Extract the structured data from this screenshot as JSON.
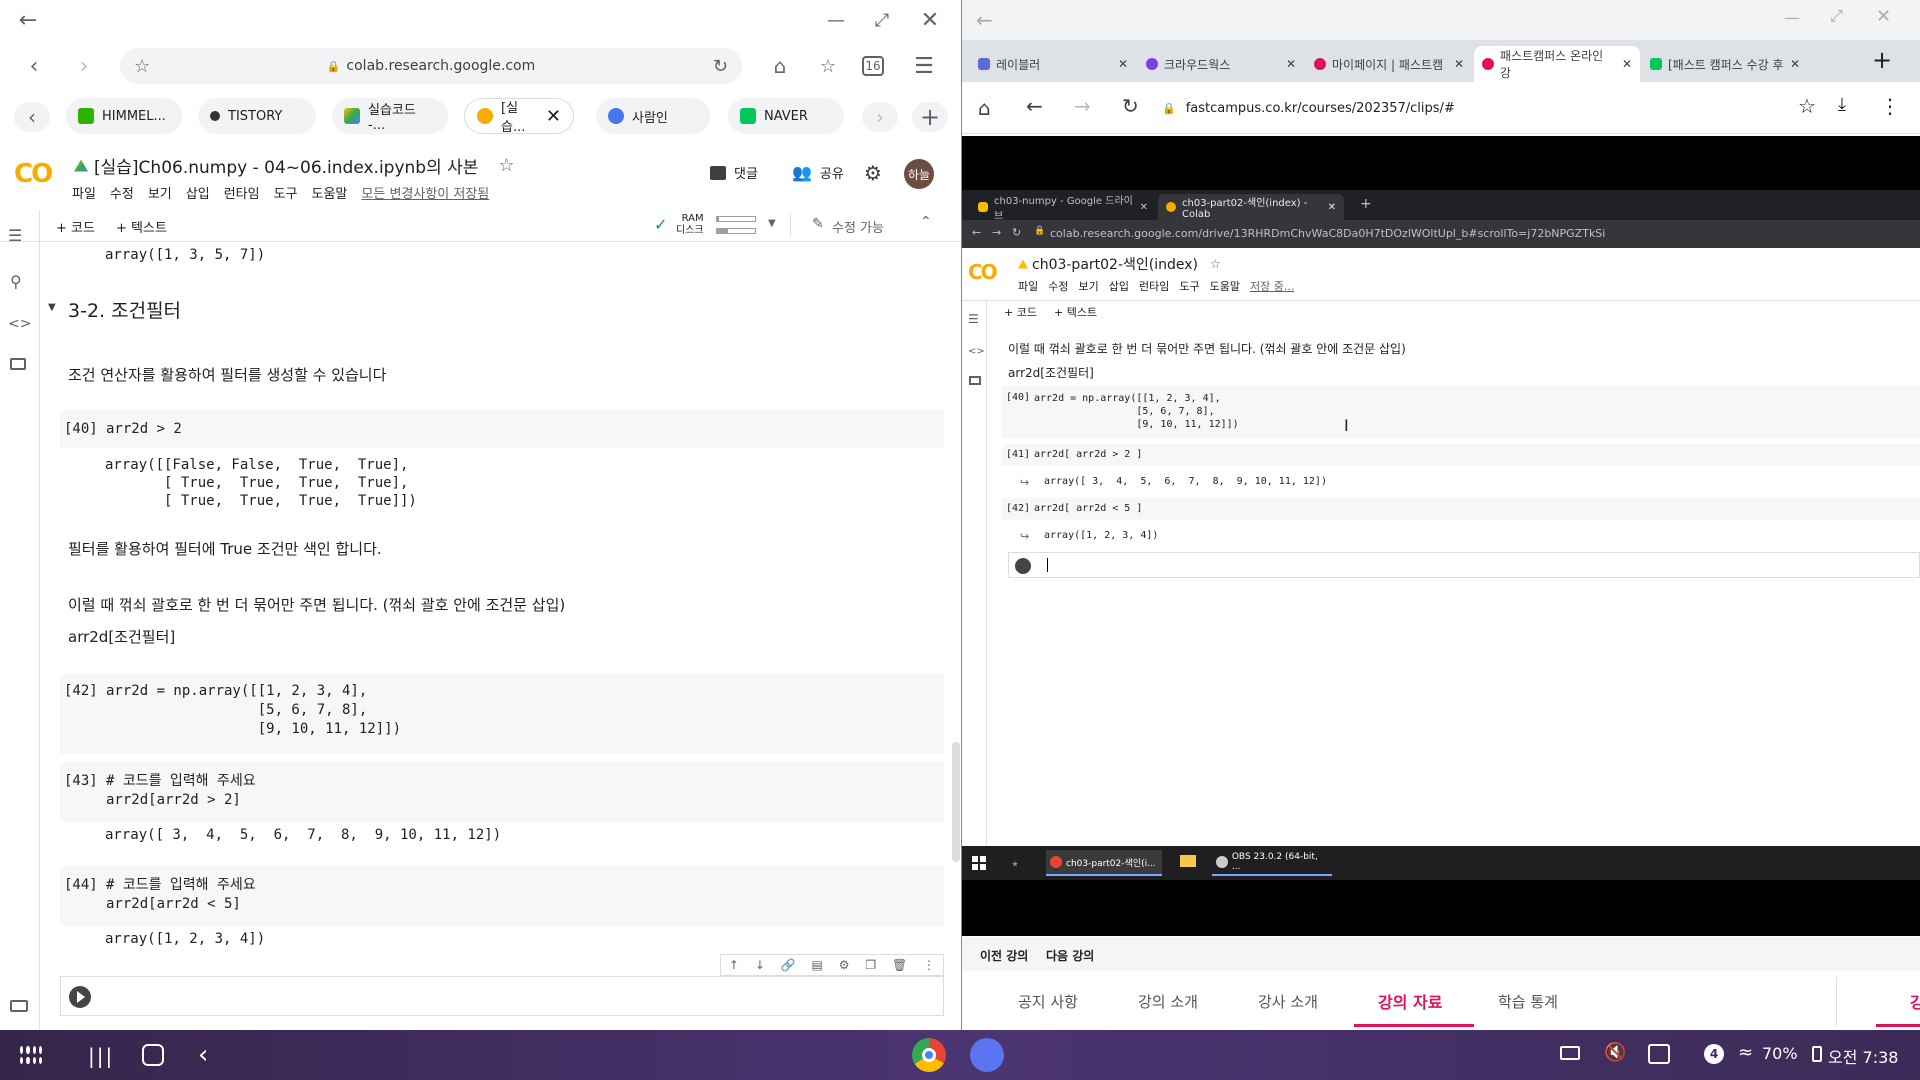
{
  "left": {
    "url": "colab.research.google.com",
    "tabs": [
      {
        "label": "HIMMEL...",
        "color": "#2db400"
      },
      {
        "label": "TISTORY",
        "color": "#333333"
      },
      {
        "label": "실습코드 -...",
        "color": "#fbbc04"
      },
      {
        "label": "[실습...",
        "color": "#f9ab00"
      },
      {
        "label": "사람인",
        "color": "#4876ef"
      },
      {
        "label": "NAVER",
        "color": "#03c75a"
      }
    ],
    "notebook_title": "[실습]Ch06.numpy - 04~06.index.ipynb의 사본",
    "menu": [
      "파일",
      "수정",
      "보기",
      "삽입",
      "런타임",
      "도구",
      "도움말"
    ],
    "saved_status": "모든 변경사항이 저장됨",
    "comment_label": "댓글",
    "share_label": "공유",
    "avatar_text": "하늘",
    "add_code": "+ 코드",
    "add_text": "+ 텍스트",
    "ram_label": "RAM",
    "disk_label": "디스크",
    "edit_label": "수정 가능",
    "prev_output": "array([1, 3, 5, 7])",
    "section_title": "3-2. 조건필터",
    "text1": "조건 연산자를 활용하여 필터를 생성할 수 있습니다",
    "cell40_num": "[40]",
    "cell40_code": "arr2d > 2",
    "cell40_out": "array([[False, False,  True,  True],\n       [ True,  True,  True,  True],\n       [ True,  True,  True,  True]])",
    "text2": "필터를 활용하여 필터에 True 조건만 색인 합니다.",
    "text3": "이럴 때 꺾쇠 괄호로 한 번 더 묶어만 주면 됩니다. (꺾쇠 괄호 안에 조건문 삽입)",
    "text4": "arr2d[조건필터]",
    "cell42_num": "[42]",
    "cell42_code": "arr2d = np.array([[1, 2, 3, 4],\n                  [5, 6, 7, 8],\n                  [9, 10, 11, 12]])",
    "cell43_num": "[43]",
    "cell43_code": "# 코드를 입력해 주세요\narr2d[arr2d > 2]",
    "cell43_out": "array([ 3,  4,  5,  6,  7,  8,  9, 10, 11, 12])",
    "cell44_num": "[44]",
    "cell44_code": "# 코드를 입력해 주세요\narr2d[arr2d < 5]",
    "cell44_out": "array([1, 2, 3, 4])"
  },
  "right": {
    "tabs": [
      "레이블러",
      "크라우드웍스",
      "마이페이지 | 패스트캠",
      "패스트캠퍼스 온라인 강",
      "[패스트 캠퍼스 수강 후"
    ],
    "url": "fastcampus.co.kr/courses/202357/clips/#",
    "inner_tabs": [
      "ch03-numpy - Google 드라이브",
      "ch03-part02-색인(index) - Colab"
    ],
    "inner_url": "colab.research.google.com/drive/13RHRDmChvWaC8Da0H7tDOzlWOltUpl_b#scrollTo=j72bNPGZTkSi",
    "inner_title": "ch03-part02-색인(index)",
    "inner_menu": [
      "파일",
      "수정",
      "보기",
      "삽입",
      "런타임",
      "도구",
      "도움말"
    ],
    "inner_saving": "저장 중...",
    "inner_add_code": "+ 코드",
    "inner_add_text": "+ 텍스트",
    "inner_text1": "이럴 때 꺾쇠 괄호로 한 번 더 묶어만 주면 됩니다. (꺾쇠 괄호 안에 조건문 삽입)",
    "inner_text2": "arr2d[조건필터]",
    "icell40_num": "[40]",
    "icell40_code": "arr2d = np.array([[1, 2, 3, 4],\n                 [5, 6, 7, 8],\n                 [9, 10, 11, 12]])",
    "icell41_num": "[41]",
    "icell41_code": "arr2d[ arr2d > 2 ]",
    "icell41_out": "array([ 3,  4,  5,  6,  7,  8,  9, 10, 11, 12])",
    "icell42_num": "[42]",
    "icell42_code": "arr2d[ arr2d < 5 ]",
    "icell42_out": "array([1, 2, 3, 4])",
    "taskbar_items": [
      "ch03-part02-색인(i...",
      "OBS 23.0.2 (64-bit, ..."
    ],
    "prev_lecture": "이전 강의",
    "next_lecture": "다음 강의",
    "lecture_tabs": [
      "공지 사항",
      "강의 소개",
      "강사 소개",
      "강의 자료",
      "학습 통계"
    ],
    "lecture_tab_cut": "강"
  },
  "system": {
    "notif_count": "4",
    "battery": "70%",
    "time": "오전 7:38"
  }
}
